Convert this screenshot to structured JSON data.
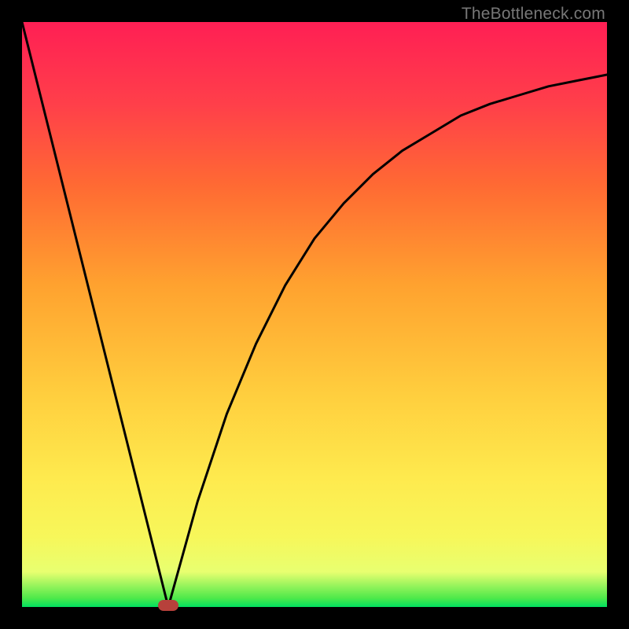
{
  "watermark": "TheBottleneck.com",
  "colors": {
    "dead_zone": "#b7413b",
    "curve": "#000000"
  },
  "chart_data": {
    "type": "line",
    "title": "",
    "xlabel": "",
    "ylabel": "",
    "xlim": [
      0,
      100
    ],
    "ylim": [
      0,
      100
    ],
    "grid": false,
    "min_point": {
      "x": 25,
      "y": 0
    },
    "series": [
      {
        "name": "bottleneck-curve",
        "x": [
          0,
          5,
          10,
          15,
          20,
          25,
          30,
          35,
          40,
          45,
          50,
          55,
          60,
          65,
          70,
          75,
          80,
          85,
          90,
          95,
          100
        ],
        "values": [
          100,
          80,
          60,
          40,
          20,
          0,
          18,
          33,
          45,
          55,
          63,
          69,
          74,
          78,
          81,
          84,
          86,
          87.5,
          89,
          90,
          91
        ]
      }
    ],
    "annotations": [
      {
        "type": "marker",
        "shape": "pill",
        "x": 25,
        "y": 0,
        "color": "#b7413b"
      }
    ]
  }
}
